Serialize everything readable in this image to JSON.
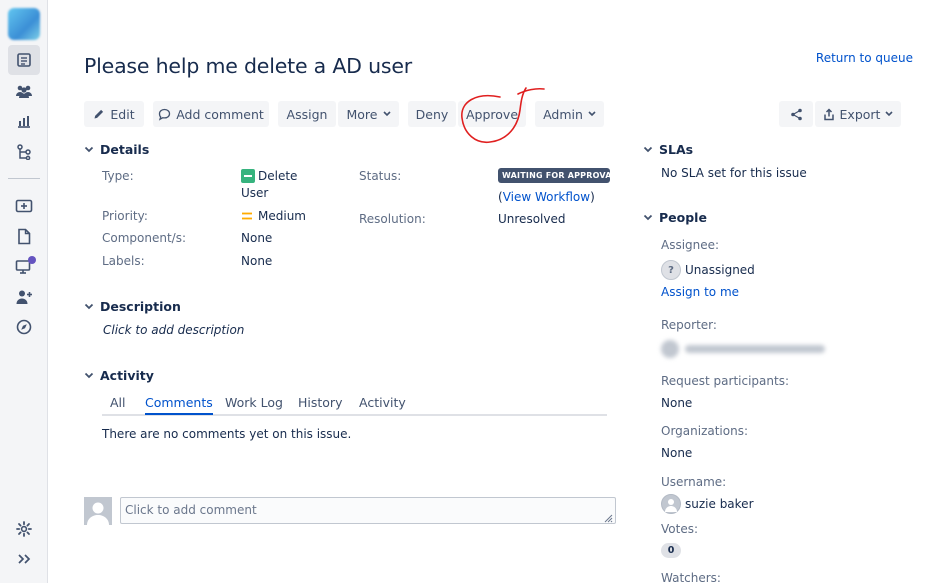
{
  "breadcrumb": "",
  "return_link": "Return to queue",
  "issue_title": "Please help me delete a AD user",
  "toolbar": {
    "edit": "Edit",
    "add_comment": "Add comment",
    "assign": "Assign",
    "more": "More",
    "deny": "Deny",
    "approve": "Approve",
    "admin": "Admin",
    "export": "Export"
  },
  "details": {
    "header": "Details",
    "type_label": "Type:",
    "type_value_line1": "Delete",
    "type_value_line2": "User",
    "priority_label": "Priority:",
    "priority_value": "Medium",
    "components_label": "Component/s:",
    "components_value": "None",
    "labels_label": "Labels:",
    "labels_value": "None",
    "status_label": "Status:",
    "status_value": "WAITING FOR APPROVAL",
    "view_workflow_open": "(",
    "view_workflow": "View Workflow",
    "view_workflow_close": ")",
    "resolution_label": "Resolution:",
    "resolution_value": "Unresolved"
  },
  "description": {
    "header": "Description",
    "placeholder": "Click to add description"
  },
  "activity": {
    "header": "Activity",
    "tabs": [
      "All",
      "Comments",
      "Work Log",
      "History",
      "Activity"
    ],
    "active_tab": "Comments",
    "empty": "There are no comments yet on this issue.",
    "comment_placeholder": "Click to add comment"
  },
  "slas": {
    "header": "SLAs",
    "text": "No SLA set for this issue"
  },
  "people": {
    "header": "People",
    "assignee_label": "Assignee:",
    "assignee_value": "Unassigned",
    "assign_to_me": "Assign to me",
    "reporter_label": "Reporter:",
    "reporter_value": "",
    "participants_label": "Request participants:",
    "participants_value": "None",
    "orgs_label": "Organizations:",
    "orgs_value": "None",
    "username_label": "Username:",
    "username_value": "suzie baker",
    "votes_label": "Votes:",
    "votes_value": "0",
    "watchers_label": "Watchers:"
  },
  "colors": {
    "link": "#0052cc",
    "button_bg": "#f4f5f7",
    "status_lozenge": "#42526e",
    "annotation": "#e02020"
  }
}
